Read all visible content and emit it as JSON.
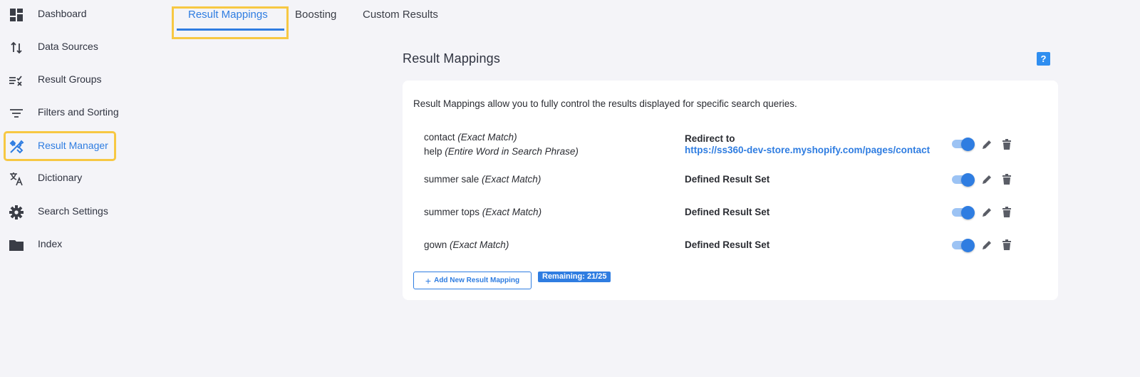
{
  "sidebar": {
    "items": [
      {
        "label": "Dashboard",
        "icon": "dashboard-icon"
      },
      {
        "label": "Data Sources",
        "icon": "swap-vertical-icon"
      },
      {
        "label": "Result Groups",
        "icon": "list-check-icon"
      },
      {
        "label": "Filters and Sorting",
        "icon": "filter-icon"
      },
      {
        "label": "Result Manager",
        "icon": "tools-icon"
      },
      {
        "label": "Dictionary",
        "icon": "translate-icon"
      },
      {
        "label": "Search Settings",
        "icon": "gear-icon"
      },
      {
        "label": "Index",
        "icon": "folder-icon"
      }
    ],
    "active_item": "Result Manager"
  },
  "tabs": [
    {
      "label": "Result Mappings"
    },
    {
      "label": "Boosting"
    },
    {
      "label": "Custom Results"
    }
  ],
  "main": {
    "title": "Result Mappings",
    "help_label": "?",
    "description": "Result Mappings allow you to fully control the results displayed for specific search queries.",
    "mappings": [
      {
        "queries": [
          {
            "term": "contact",
            "match": "(Exact Match)"
          },
          {
            "term": "help",
            "match": "(Entire Word in Search Phrase)"
          }
        ],
        "target_label": "Redirect to",
        "target_link": "https://ss360-dev-store.myshopify.com/pages/contact",
        "enabled": true
      },
      {
        "queries": [
          {
            "term": "summer sale",
            "match": "(Exact Match)"
          }
        ],
        "target_label": "Defined Result Set",
        "enabled": true
      },
      {
        "queries": [
          {
            "term": "summer tops",
            "match": "(Exact Match)"
          }
        ],
        "target_label": "Defined Result Set",
        "enabled": true
      },
      {
        "queries": [
          {
            "term": "gown",
            "match": "(Exact Match)"
          }
        ],
        "target_label": "Defined Result Set",
        "enabled": true
      }
    ],
    "add_button_label": "Add New Result Mapping",
    "remaining_label": "Remaining: 21/25"
  },
  "colors": {
    "accent": "#2f7de1",
    "highlight": "#f7c843",
    "background": "#f4f4f8"
  }
}
